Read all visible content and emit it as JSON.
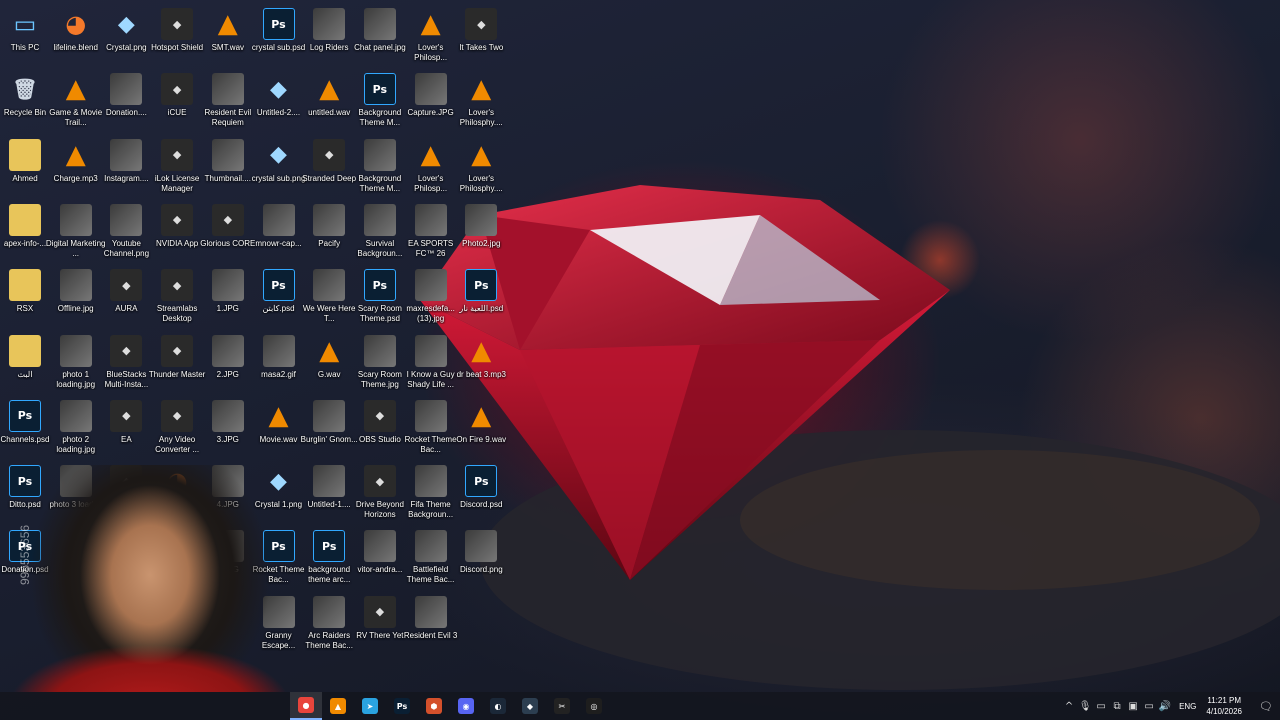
{
  "desktop": {
    "icons": [
      {
        "label": "This PC",
        "kind": "pc"
      },
      {
        "label": "lifeline.blend",
        "kind": "blend"
      },
      {
        "label": "Crystal.png",
        "kind": "gem"
      },
      {
        "label": "Hotspot Shield",
        "kind": "app"
      },
      {
        "label": "SMT.wav",
        "kind": "vlc"
      },
      {
        "label": "crystal sub.psd",
        "kind": "ps"
      },
      {
        "label": "Log Riders",
        "kind": "img"
      },
      {
        "label": "Chat panel.jpg",
        "kind": "img"
      },
      {
        "label": "Lover's Philosp...",
        "kind": "vlc"
      },
      {
        "label": "It Takes Two",
        "kind": "app"
      },
      {
        "label": "Recycle Bin",
        "kind": "bin"
      },
      {
        "label": "Game & Movie Trail...",
        "kind": "vlc"
      },
      {
        "label": "Donation....",
        "kind": "img"
      },
      {
        "label": "iCUE",
        "kind": "app"
      },
      {
        "label": "Resident Evil Requiem",
        "kind": "img"
      },
      {
        "label": "Untitled-2....",
        "kind": "gem"
      },
      {
        "label": "untitled.wav",
        "kind": "vlc"
      },
      {
        "label": "Background Theme M...",
        "kind": "ps"
      },
      {
        "label": "Capture.JPG",
        "kind": "img"
      },
      {
        "label": "Lover's Philosphy....",
        "kind": "vlc"
      },
      {
        "label": "Ahmed",
        "kind": "folder"
      },
      {
        "label": "Charge.mp3",
        "kind": "vlc"
      },
      {
        "label": "Instagram....",
        "kind": "img"
      },
      {
        "label": "iLok License Manager",
        "kind": "app"
      },
      {
        "label": "Thumbnail....",
        "kind": "img"
      },
      {
        "label": "crystal sub.png",
        "kind": "gem"
      },
      {
        "label": "Stranded Deep",
        "kind": "app"
      },
      {
        "label": "Background Theme M...",
        "kind": "img"
      },
      {
        "label": "Lover's Philosp...",
        "kind": "vlc"
      },
      {
        "label": "Lover's Philosphy....",
        "kind": "vlc"
      },
      {
        "label": "apex-info-...",
        "kind": "folder"
      },
      {
        "label": "Digital Marketing ...",
        "kind": "img"
      },
      {
        "label": "Youtube Channel.png",
        "kind": "img"
      },
      {
        "label": "NVIDIA App",
        "kind": "app"
      },
      {
        "label": "Glorious CORE",
        "kind": "app"
      },
      {
        "label": "mnowr-cap...",
        "kind": "img"
      },
      {
        "label": "Pacify",
        "kind": "img"
      },
      {
        "label": "Survival Backgroun...",
        "kind": "img"
      },
      {
        "label": "EA SPORTS FC™ 26",
        "kind": "img"
      },
      {
        "label": "Photo2.jpg",
        "kind": "img"
      },
      {
        "label": "RSX",
        "kind": "folder"
      },
      {
        "label": "Offline.jpg",
        "kind": "img"
      },
      {
        "label": "AURA",
        "kind": "app"
      },
      {
        "label": "Streamlabs Desktop",
        "kind": "app"
      },
      {
        "label": "1.JPG",
        "kind": "img"
      },
      {
        "label": "كابتن.psd",
        "kind": "ps"
      },
      {
        "label": "We Were Here T...",
        "kind": "img"
      },
      {
        "label": "Scary Room Theme.psd",
        "kind": "ps"
      },
      {
        "label": "maxresdefa... (13).jpg",
        "kind": "img"
      },
      {
        "label": "اللعبة نار.psd",
        "kind": "ps"
      },
      {
        "label": "البث",
        "kind": "folder"
      },
      {
        "label": "photo 1 loading.jpg",
        "kind": "img"
      },
      {
        "label": "BlueStacks Multi-Insta...",
        "kind": "app"
      },
      {
        "label": "Thunder Master",
        "kind": "app"
      },
      {
        "label": "2.JPG",
        "kind": "img"
      },
      {
        "label": "masa2.gif",
        "kind": "img"
      },
      {
        "label": "G.wav",
        "kind": "vlc"
      },
      {
        "label": "Scary Room Theme.jpg",
        "kind": "img"
      },
      {
        "label": "I Know a Guy Shady Life ...",
        "kind": "img"
      },
      {
        "label": "dr beat 3.mp3",
        "kind": "vlc"
      },
      {
        "label": "Channels.psd",
        "kind": "ps"
      },
      {
        "label": "photo 2 loading.jpg",
        "kind": "img"
      },
      {
        "label": "EA",
        "kind": "app"
      },
      {
        "label": "Any Video Converter ...",
        "kind": "app"
      },
      {
        "label": "3.JPG",
        "kind": "img"
      },
      {
        "label": "Movie.wav",
        "kind": "vlc"
      },
      {
        "label": "Burglin' Gnom...",
        "kind": "img"
      },
      {
        "label": "OBS Studio",
        "kind": "app"
      },
      {
        "label": "Rocket Theme Bac...",
        "kind": "img"
      },
      {
        "label": "On Fire 9.wav",
        "kind": "vlc"
      },
      {
        "label": "Ditto.psd",
        "kind": "ps"
      },
      {
        "label": "photo 3 loadi...",
        "kind": "img"
      },
      {
        "label": "4K",
        "kind": "app"
      },
      {
        "label": "2",
        "kind": "blend"
      },
      {
        "label": "4.JPG",
        "kind": "img"
      },
      {
        "label": "Crystal 1.png",
        "kind": "gem"
      },
      {
        "label": "Untitled-1....",
        "kind": "img"
      },
      {
        "label": "Drive Beyond Horizons",
        "kind": "app"
      },
      {
        "label": "Fifa Theme Backgroun...",
        "kind": "img"
      },
      {
        "label": "Discord.psd",
        "kind": "ps"
      },
      {
        "label": "Donation.psd",
        "kind": "ps"
      },
      {
        "label": "",
        "kind": "none"
      },
      {
        "label": "",
        "kind": "none"
      },
      {
        "label": "",
        "kind": "none"
      },
      {
        "label": "5.JPG",
        "kind": "img"
      },
      {
        "label": "Rocket Theme Bac...",
        "kind": "ps"
      },
      {
        "label": "background theme arc...",
        "kind": "ps"
      },
      {
        "label": "vitor-andra...",
        "kind": "img"
      },
      {
        "label": "Battlefield Theme Bac...",
        "kind": "img"
      },
      {
        "label": "Discord.png",
        "kind": "img"
      },
      {
        "label": "",
        "kind": "none"
      },
      {
        "label": "",
        "kind": "none"
      },
      {
        "label": "",
        "kind": "none"
      },
      {
        "label": "",
        "kind": "none"
      },
      {
        "label": "",
        "kind": "none"
      },
      {
        "label": "Granny Escape...",
        "kind": "img"
      },
      {
        "label": "Arc Raiders Theme Bac...",
        "kind": "img"
      },
      {
        "label": "RV There Yet",
        "kind": "app"
      },
      {
        "label": "Resident Evil 3",
        "kind": "img"
      },
      {
        "label": "",
        "kind": "none"
      }
    ]
  },
  "wallpaper": {
    "watermark": "Adobe Stock",
    "stock_id": "996553656"
  },
  "taskbar": {
    "apps": [
      {
        "name": "chrome",
        "glyph": "●",
        "color": "#e8453c"
      },
      {
        "name": "vlc",
        "glyph": "▲",
        "color": "#f08a00"
      },
      {
        "name": "telegram",
        "glyph": "➤",
        "color": "#2aa3e0"
      },
      {
        "name": "photoshop",
        "glyph": "Ps",
        "color": "#0a1f33"
      },
      {
        "name": "gpu-tool",
        "glyph": "⬢",
        "color": "#d4502b"
      },
      {
        "name": "discord",
        "glyph": "◉",
        "color": "#5865f2"
      },
      {
        "name": "steam",
        "glyph": "◐",
        "color": "#1b2838"
      },
      {
        "name": "dev-tool",
        "glyph": "◆",
        "color": "#2c3e50"
      },
      {
        "name": "capcut",
        "glyph": "✂",
        "color": "#222222"
      },
      {
        "name": "obs",
        "glyph": "◎",
        "color": "#1e1e1e"
      }
    ],
    "tray": {
      "chevron": "^",
      "language": "ENG",
      "time": "11:21 PM",
      "date": "4/10/2026"
    }
  },
  "colors": {
    "accent": "#7fb3ff",
    "gem": "#c8142f",
    "taskbar": "#14161e"
  }
}
